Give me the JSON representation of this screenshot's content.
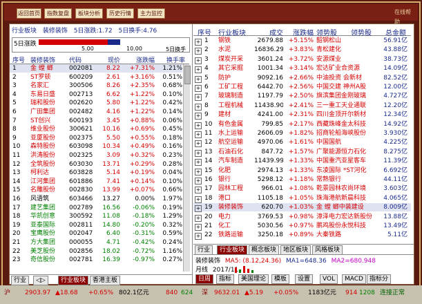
{
  "toolbar": {
    "buttons": [
      "返回首页",
      "指数复盘",
      "板块分析",
      "历史行情",
      "主力监控"
    ],
    "right_label": "在线帮助"
  },
  "left_header": {
    "title": "行业板块",
    "board": "装修装饰",
    "rise5": "5日涨跌:1.72",
    "turn5": "5日换手:4.76",
    "mini_label": "5日涨跌",
    "ticks": [
      "5.00",
      "10.00",
      "5日换手"
    ],
    "headers": [
      "序号",
      "装修装饰",
      "代码",
      "现价",
      "涨跌幅",
      "换手率"
    ]
  },
  "left_rows": [
    [
      "1",
      "金 螳 螂",
      "002081",
      "8.22",
      "+7.31%",
      "1.21%",
      "up"
    ],
    [
      "2",
      "ST罗顿",
      "600209",
      "2.61",
      "+3.16%",
      "0.51%",
      "up"
    ],
    [
      "3",
      "名家汇",
      "300506",
      "8.26",
      "+2.35%",
      "0.68%",
      "up"
    ],
    [
      "4",
      "东易日盛",
      "002713",
      "6.62",
      "+1.22%",
      "0.10%",
      "up"
    ],
    [
      "5",
      "瑞和股份",
      "002620",
      "5.80",
      "+1.22%",
      "0.42%",
      "up"
    ],
    [
      "6",
      "广田集团",
      "002482",
      "4.16",
      "+1.22%",
      "0.14%",
      "up"
    ],
    [
      "7",
      "ST创兴",
      "600193",
      "3.45",
      "+0.88%",
      "0.06%",
      "up"
    ],
    [
      "8",
      "维业股份",
      "300621",
      "10.16",
      "+0.69%",
      "0.45%",
      "up"
    ],
    [
      "9",
      "亚厦股份",
      "002375",
      "5.50",
      "+0.55%",
      "0.18%",
      "up"
    ],
    [
      "10",
      "森特股份",
      "603098",
      "10.34",
      "+0.49%",
      "0.16%",
      "up"
    ],
    [
      "11",
      "洪涛股份",
      "002325",
      "3.09",
      "+0.32%",
      "0.23%",
      "up"
    ],
    [
      "12",
      "全筑股份",
      "603030",
      "13.71",
      "+0.29%",
      "0.28%",
      "up"
    ],
    [
      "13",
      "柯利达",
      "603828",
      "5.14",
      "+0.19%",
      "0.04%",
      "up"
    ],
    [
      "14",
      "江河集团",
      "601886",
      "7.41",
      "+0.14%",
      "0.10%",
      "up"
    ],
    [
      "15",
      "名雕股份",
      "002830",
      "13.99",
      "+0.07%",
      "0.66%",
      "up"
    ],
    [
      "16",
      "风语筑",
      "603466",
      "13.27",
      "0.00%",
      "1.97%",
      "flat"
    ],
    [
      "17",
      "建艺集团",
      "002789",
      "16.56",
      "-0.06%",
      "0.19%",
      "dn"
    ],
    [
      "18",
      "华凯创意",
      "300592",
      "11.08",
      "-0.18%",
      "1.29%",
      "dn"
    ],
    [
      "19",
      "亚泰国际",
      "002811",
      "14.80",
      "-0.20%",
      "0.32%",
      "dn"
    ],
    [
      "20",
      "宝鹰股份",
      "002047",
      "6.40",
      "-0.31%",
      "0.59%",
      "dn"
    ],
    [
      "21",
      "方大集团",
      "000055",
      "4.71",
      "-0.42%",
      "0.24%",
      "dn"
    ],
    [
      "22",
      "美芝股份",
      "002856",
      "18.02",
      "-0.72%",
      "1.16%",
      "dn"
    ],
    [
      "23",
      "奇信股份",
      "002781",
      "16.39",
      "-0.97%",
      "0.27%",
      "dn"
    ]
  ],
  "left_tabs": [
    "行业",
    "◁▷",
    "行业板块",
    "香港主板"
  ],
  "right_header": {
    "headers": [
      "序号",
      "行业板块",
      "成交",
      "涨跌幅",
      "领势股",
      "领势股",
      "总金额"
    ]
  },
  "right_rows": [
    [
      "1",
      "钢铁",
      "2679.88",
      "+5.15%",
      "韶钢松山",
      "56.91亿",
      "up"
    ],
    [
      "2",
      "水泥",
      "16836.29",
      "+3.83%",
      "青松建化",
      "43.88亿",
      "up"
    ],
    [
      "3",
      "煤炭开采",
      "3601.24",
      "+3.72%",
      "安源煤业",
      "38.73亿",
      "up"
    ],
    [
      "4",
      "其它采掘",
      "1001.34",
      "+3.14%",
      "宏达矿业合资源",
      "14.09亿",
      "up"
    ],
    [
      "5",
      "防护",
      "9092.16",
      "+2.66%",
      "中油投资 会新材",
      "82.52亿",
      "up"
    ],
    [
      "6",
      "工矿工程",
      "6442.70",
      "+2.56%",
      "中国交建 神州A股",
      "12.00亿",
      "up"
    ],
    [
      "7",
      "玻璃制造",
      "1197.79",
      "+2.50%",
      "旗滨集团金刚玻璃",
      "4.727亿",
      "up"
    ],
    [
      "8",
      "工程机械",
      "11438.90",
      "+2.41%",
      "三一重工天业通联",
      "12.20亿",
      "up"
    ],
    [
      "9",
      "建材",
      "4241.00",
      "+2.31%",
      "四川金顶开尔新材",
      "12.34亿",
      "up"
    ],
    [
      "10",
      "有色金属",
      "799.85",
      "+2.17%",
      "西藏珠峰金太科技",
      "14.92亿",
      "up"
    ],
    [
      "11",
      "水上运输",
      "2606.09",
      "+1.82%",
      "招商轮船海峡股份",
      "3.930亿",
      "up"
    ],
    [
      "12",
      "航空运输",
      "4970.06",
      "+1.61%",
      "中国国航",
      "4.225亿",
      "up"
    ],
    [
      "13",
      "石油石化",
      "847.72",
      "+1.57%",
      "广聚能源恒力石化",
      "8.275亿",
      "up"
    ],
    [
      "14",
      "汽车制造",
      "11439.99",
      "+1.33%",
      "中国重汽亚星客车",
      "11.39亿",
      "up"
    ],
    [
      "15",
      "化肥",
      "2974.13",
      "+1.33%",
      "东凌国际 *ST河化",
      "6.692亿",
      "up"
    ],
    [
      "16",
      "银行",
      "5298.12",
      "+1.18%",
      "常熟银行",
      "44.11亿",
      "up"
    ],
    [
      "17",
      "园林工程",
      "966.01",
      "+1.08%",
      "乾景园林农尚环境",
      "3.603亿",
      "up"
    ],
    [
      "18",
      "港口",
      "1105.18",
      "+1.05%",
      "珠海港航新晨科技",
      "4.065亿",
      "up"
    ],
    [
      "19",
      "装修装饰",
      "620.70",
      "+1.03%",
      "金 螳 螂中装建设",
      "8.009亿",
      "up"
    ],
    [
      "20",
      "电力",
      "3769.53",
      "+0.98%",
      "漳泽电力宏达新股份",
      "13.88亿",
      "up"
    ],
    [
      "21",
      "化工",
      "5030.56",
      "+0.97%",
      "鹏鸡股份永悦科技",
      "13.49亿",
      "up"
    ],
    [
      "22",
      "铁路运输",
      "3250.18",
      "+0.89%",
      "大秦铁路",
      "5.11亿",
      "up"
    ]
  ],
  "right_tabs": [
    "行业",
    "行业板块",
    "概念板块",
    "地区板块",
    "风格板块"
  ],
  "mini_chart": {
    "title": "装修装饰",
    "ma": "MA5: (8.12,24.36)",
    "ma1": "MA1=648.36",
    "ma2": "MA2=680.948",
    "date": "月线",
    "year": "2017/11"
  },
  "bottom_tabs": [
    "日周",
    "指标",
    "美国理论",
    "模板",
    "设置",
    "VOL",
    "MACD",
    "指标分"
  ],
  "status": {
    "label": "沪",
    "sh_value": "2903.97",
    "sh_change": "▲18.68",
    "sh_pct": "+0.65%",
    "sh_amount": "802.1亿元",
    "sh_value2": "840",
    "sh_extra": "624",
    "sz_label": "深",
    "sz_value": "9632.01",
    "sz_change": "▲5.19",
    "sz_pct": "+0.05%",
    "sz_amount": "1183亿元",
    "sz_extra": "914",
    "sz_extra2": "1208",
    "conn": "连接正常"
  }
}
